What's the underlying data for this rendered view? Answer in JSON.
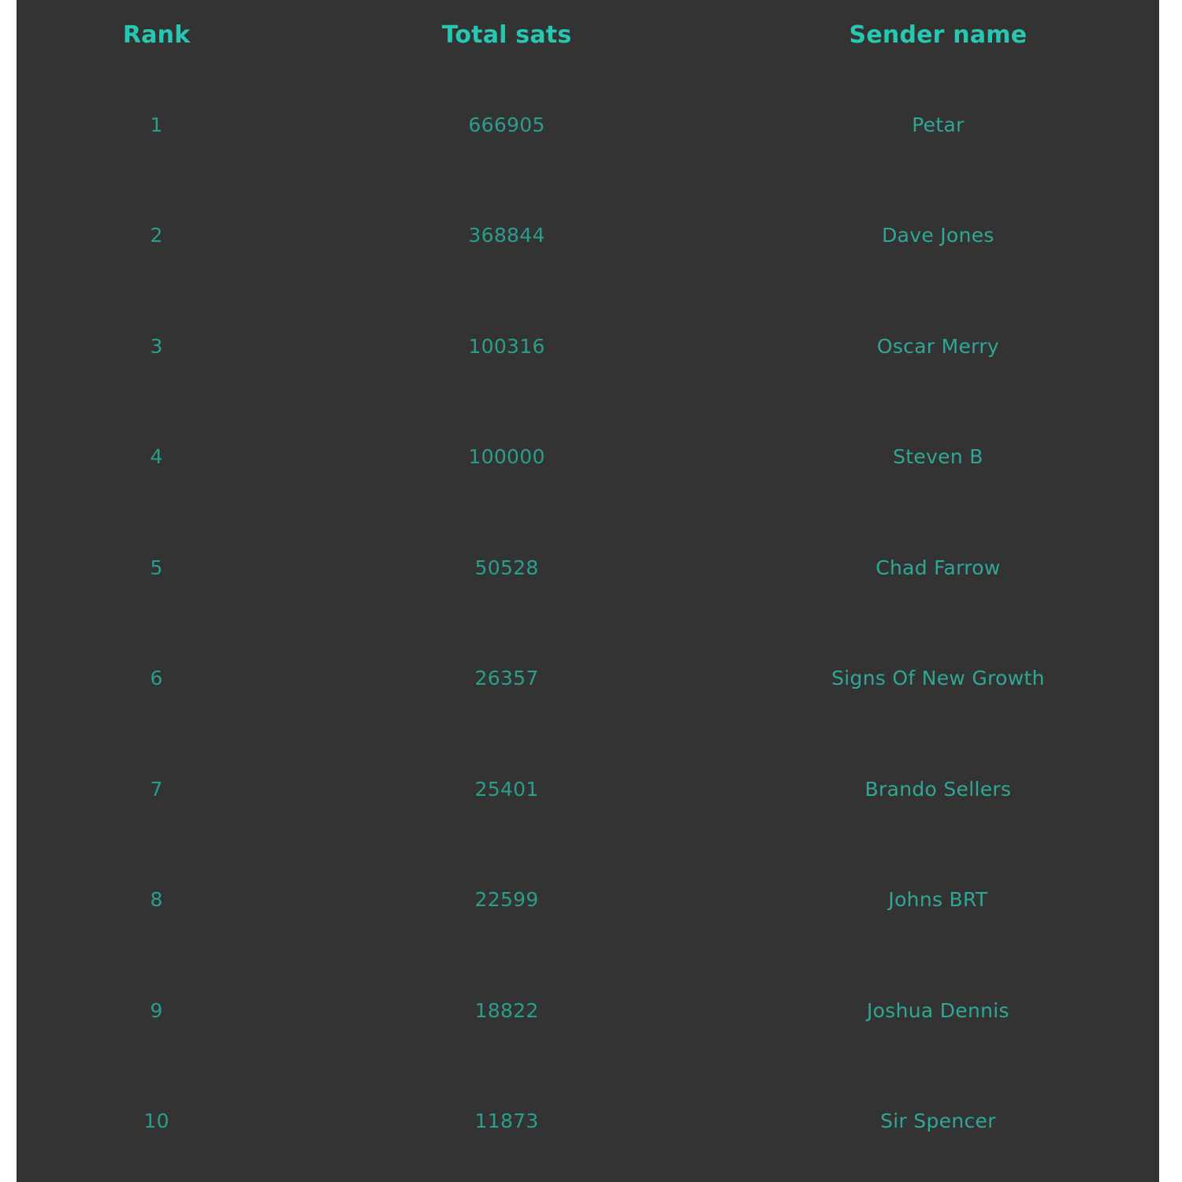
{
  "panel": {
    "background_color": "#333333",
    "page_background_color": "#ffffff",
    "header_color": "#26c8b2",
    "body_color": "#2a9d8c"
  },
  "table": {
    "columns": [
      {
        "key": "rank",
        "label": "Rank"
      },
      {
        "key": "sats",
        "label": "Total sats"
      },
      {
        "key": "sender",
        "label": "Sender name"
      }
    ],
    "rows": [
      {
        "rank": "1",
        "sats": "666905",
        "sender": "Petar"
      },
      {
        "rank": "2",
        "sats": "368844",
        "sender": "Dave Jones"
      },
      {
        "rank": "3",
        "sats": "100316",
        "sender": "Oscar Merry"
      },
      {
        "rank": "4",
        "sats": "100000",
        "sender": "Steven B"
      },
      {
        "rank": "5",
        "sats": "50528",
        "sender": "Chad Farrow"
      },
      {
        "rank": "6",
        "sats": "26357",
        "sender": "Signs Of New Growth"
      },
      {
        "rank": "7",
        "sats": "25401",
        "sender": "Brando Sellers"
      },
      {
        "rank": "8",
        "sats": "22599",
        "sender": "Johns BRT"
      },
      {
        "rank": "9",
        "sats": "18822",
        "sender": "Joshua Dennis"
      },
      {
        "rank": "10",
        "sats": "11873",
        "sender": "Sir Spencer"
      }
    ]
  },
  "chart_data": {
    "type": "table",
    "title": "",
    "columns": [
      "Rank",
      "Total sats",
      "Sender name"
    ],
    "categories": [
      "Petar",
      "Dave Jones",
      "Oscar Merry",
      "Steven B",
      "Chad Farrow",
      "Signs Of New Growth",
      "Brando Sellers",
      "Johns BRT",
      "Joshua Dennis",
      "Sir Spencer"
    ],
    "values": [
      666905,
      368844,
      100316,
      100000,
      50528,
      26357,
      25401,
      22599,
      18822,
      11873
    ],
    "ranks": [
      1,
      2,
      3,
      4,
      5,
      6,
      7,
      8,
      9,
      10
    ],
    "xlabel": "Sender name",
    "ylabel": "Total sats",
    "legend": [],
    "grid": false
  }
}
